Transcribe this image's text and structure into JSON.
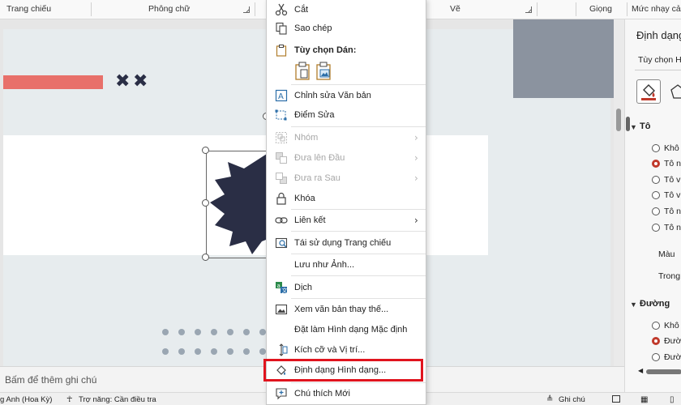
{
  "ribbon": {
    "groups": [
      "Trang chiếu",
      "Phông chữ",
      "Vẽ",
      "Giọng",
      "Mức nhạy cảm"
    ]
  },
  "slide": {
    "marks": [
      "✖",
      "✖"
    ]
  },
  "notes": {
    "placeholder": "Bấm để thêm ghi chú"
  },
  "status": {
    "language": "g Anh (Hoa Kỳ)",
    "accessibility": "Trợ năng: Cần điều tra",
    "notes_button": "Ghi chú"
  },
  "format_pane": {
    "title": "Định dạng",
    "tab": "Tùy chọn Hình",
    "fill_section": "Tô",
    "fill_options": [
      "Khô",
      "Tô n",
      "Tô v",
      "Tô v",
      "Tô n",
      "Tô n"
    ],
    "color_label": "Màu",
    "transparency_label": "Trong",
    "line_section": "Đường",
    "line_options": [
      "Khô",
      "Đườ",
      "Đườ"
    ]
  },
  "context_menu": {
    "cut": "Cắt",
    "copy": "Sao chép",
    "paste_options_header": "Tùy chọn Dán:",
    "edit_text": "Chỉnh sửa Văn bản",
    "edit_points": "Điểm Sửa",
    "group": "Nhóm",
    "bring_forward": "Đưa lên Đầu",
    "send_backward": "Đưa ra Sau",
    "lock": "Khóa",
    "link": "Liên kết",
    "reuse_slides": "Tái sử dụng Trang chiếu",
    "save_as_picture": "Lưu như Ảnh...",
    "translate": "Dịch",
    "view_alt_text": "Xem văn bản thay thế...",
    "set_default_shape": "Đặt làm Hình dạng Mặc định",
    "size_position": "Kích cỡ và Vị trí...",
    "format_shape": "Định dạng Hình dạng...",
    "new_comment": "Chú thích Mới"
  },
  "colors": {
    "accent_red": "#e0141e",
    "bar_coral": "#e8706a",
    "shape_navy": "#2a2e45",
    "slate_block": "#8b939f"
  }
}
